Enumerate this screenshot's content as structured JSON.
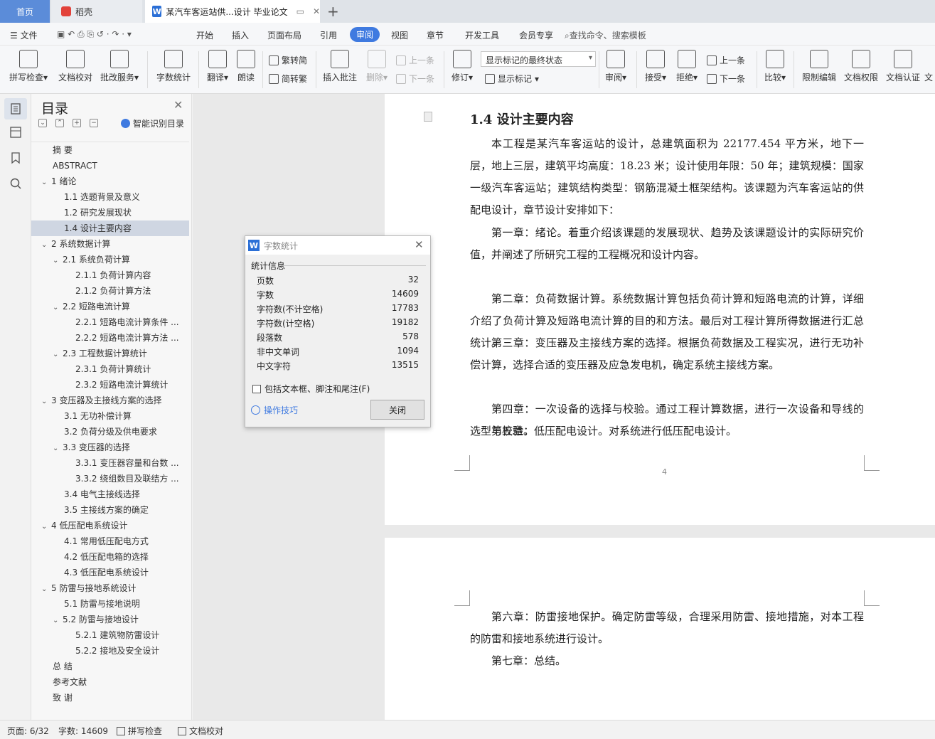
{
  "tabs": {
    "home": "首页",
    "daoke": "稻壳",
    "doc": "某汽车客运站供...设计 毕业论文",
    "newtab": "+"
  },
  "menu": {
    "file": "文件",
    "items": [
      "开始",
      "插入",
      "页面布局",
      "引用",
      "审阅",
      "视图",
      "章节",
      "开发工具",
      "会员专享"
    ],
    "active": "审阅",
    "search": "查找命令、搜索模板"
  },
  "ribbon": {
    "spell": "拼写检查",
    "proof": "文档校对",
    "correct": "批改服务",
    "wordcount": "字数统计",
    "translate": "翻译",
    "read": "朗读",
    "trad": "繁转简",
    "simp": "简转繁",
    "insert_comment": "插入批注",
    "delete": "删除",
    "prev": "上一条",
    "next": "下一条",
    "revise": "修订",
    "mark_select": "显示标记的最终状态",
    "show_marks": "显示标记",
    "review": "审阅",
    "accept": "接受",
    "reject": "拒绝",
    "prev2": "上一条",
    "next2": "下一条",
    "compare": "比较",
    "limit_edit": "限制编辑",
    "doc_perm": "文档权限",
    "doc_cert": "文档认证",
    "more": "文"
  },
  "toc": {
    "title": "目录",
    "smart": "智能识别目录",
    "items": [
      {
        "label": "摘 要",
        "level": 0,
        "car": ""
      },
      {
        "label": "ABSTRACT",
        "level": 0,
        "car": ""
      },
      {
        "label": "1 绪论",
        "level": 0,
        "car": "v"
      },
      {
        "label": "1.1 选题背景及意义",
        "level": 1,
        "car": ""
      },
      {
        "label": "1.2 研究发展现状",
        "level": 1,
        "car": ""
      },
      {
        "label": "1.4 设计主要内容",
        "level": 1,
        "car": "",
        "sel": true
      },
      {
        "label": "2 系统数据计算",
        "level": 0,
        "car": "v"
      },
      {
        "label": "2.1 系统负荷计算",
        "level": 1,
        "car": "v"
      },
      {
        "label": "2.1.1 负荷计算内容",
        "level": 2,
        "car": ""
      },
      {
        "label": "2.1.2 负荷计算方法",
        "level": 2,
        "car": ""
      },
      {
        "label": "2.2 短路电流计算",
        "level": 1,
        "car": "v"
      },
      {
        "label": "2.2.1 短路电流计算条件 ...",
        "level": 2,
        "car": ""
      },
      {
        "label": "2.2.2 短路电流计算方法 ...",
        "level": 2,
        "car": ""
      },
      {
        "label": "2.3 工程数据计算统计",
        "level": 1,
        "car": "v"
      },
      {
        "label": "2.3.1 负荷计算统计",
        "level": 2,
        "car": ""
      },
      {
        "label": "2.3.2 短路电流计算统计",
        "level": 2,
        "car": ""
      },
      {
        "label": "3 变压器及主接线方案的选择",
        "level": 0,
        "car": "v"
      },
      {
        "label": "3.1 无功补偿计算",
        "level": 1,
        "car": ""
      },
      {
        "label": "3.2 负荷分级及供电要求",
        "level": 1,
        "car": ""
      },
      {
        "label": "3.3 变压器的选择",
        "level": 1,
        "car": "v"
      },
      {
        "label": "3.3.1 变压器容量和台数 ...",
        "level": 2,
        "car": ""
      },
      {
        "label": "3.3.2 绕组数目及联结方 ...",
        "level": 2,
        "car": ""
      },
      {
        "label": "3.4 电气主接线选择",
        "level": 1,
        "car": ""
      },
      {
        "label": "3.5 主接线方案的确定",
        "level": 1,
        "car": ""
      },
      {
        "label": "4 低压配电系统设计",
        "level": 0,
        "car": "v"
      },
      {
        "label": "4.1 常用低压配电方式",
        "level": 1,
        "car": ""
      },
      {
        "label": "4.2 低压配电箱的选择",
        "level": 1,
        "car": ""
      },
      {
        "label": "4.3 低压配电系统设计",
        "level": 1,
        "car": ""
      },
      {
        "label": "5 防雷与接地系统设计",
        "level": 0,
        "car": "v"
      },
      {
        "label": "5.1 防雷与接地说明",
        "level": 1,
        "car": ""
      },
      {
        "label": "5.2 防雷与接地设计",
        "level": 1,
        "car": "v"
      },
      {
        "label": "5.2.1 建筑物防雷设计",
        "level": 2,
        "car": ""
      },
      {
        "label": "5.2.2 接地及安全设计",
        "level": 2,
        "car": ""
      },
      {
        "label": "总 结",
        "level": 0,
        "car": ""
      },
      {
        "label": "参考文献",
        "level": 0,
        "car": ""
      },
      {
        "label": "致 谢",
        "level": 0,
        "car": ""
      }
    ]
  },
  "doc": {
    "heading": "1.4 设计主要内容",
    "paragraphs": [
      "本工程是某汽车客运站的设计，总建筑面积为 22177.454 平方米，地下一层，地上三层，建筑平均高度：18.23 米；设计使用年限：50 年；建筑规模：国家一级汽车客运站；建筑结构类型：钢筋混凝土框架结构。该课题为汽车客运站的供配电设计，章节设计安排如下：",
      "第一章：绪论。着重介绍该课题的发展现状、趋势及该课题设计的实际研究价值，并阐述了所研究工程的工程概况和设计内容。",
      "第二章：负荷数据计算。系统数据计算包括负荷计算和短路电流的计算，详细介绍了负荷计算及短路电流计算的目的和方法。最后对工程计算所得数据进行汇总统计。",
      "第三章：变压器及主接线方案的选择。根据负荷数据及工程实况，进行无功补偿计算，选择合适的变压器及应急发电机，确定系统主接线方案。",
      "第四章：一次设备的选择与校验。通过工程计算数据，进行一次设备和导线的选型与校验。",
      "第五章：低压配电设计。对系统进行低压配电设计。"
    ],
    "page_number": "4",
    "paragraphs2": [
      "第六章：防雷接地保护。确定防雷等级，合理采用防雷、接地措施，对本工程的防雷和接地系统进行设计。",
      "第七章：总结。"
    ]
  },
  "dialog": {
    "title": "字数统计",
    "section": "统计信息",
    "rows": [
      {
        "label": "页数",
        "value": "32"
      },
      {
        "label": "字数",
        "value": "14609"
      },
      {
        "label": "字符数(不计空格)",
        "value": "17783"
      },
      {
        "label": "字符数(计空格)",
        "value": "19182"
      },
      {
        "label": "段落数",
        "value": "578"
      },
      {
        "label": "非中文单词",
        "value": "1094"
      },
      {
        "label": "中文字符",
        "value": "13515"
      }
    ],
    "checkbox": "包括文本框、脚注和尾注(F)",
    "tips": "操作技巧",
    "close": "关闭"
  },
  "status": {
    "page": "页面: 6/32",
    "words": "字数: 14609",
    "spell": "拼写检查",
    "proof": "文档校对"
  },
  "colors": {
    "accent": "#3f7ae0",
    "home_tab": "#5b8cd9"
  }
}
